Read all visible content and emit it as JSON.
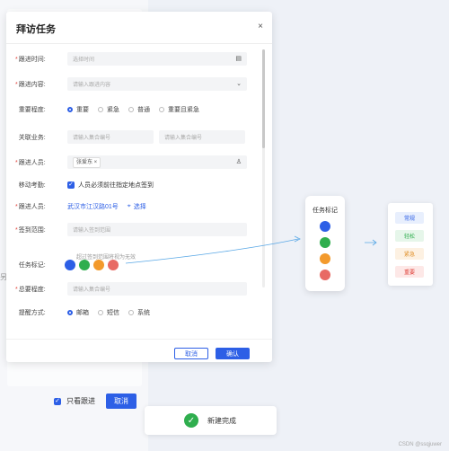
{
  "modal": {
    "title": "拜访任务",
    "close_icon": "×"
  },
  "form": {
    "follow_time": {
      "label": "跟进时间:",
      "placeholder": "选择时间"
    },
    "follow_content": {
      "label": "跟进内容:",
      "placeholder": "请输入跟进内容"
    },
    "importance": {
      "label": "重要程度:",
      "options": [
        "重要",
        "紧急",
        "普通",
        "重要且紧急"
      ],
      "selected": "重要"
    },
    "related_business": {
      "label": "关联业务:",
      "placeholder1": "请输入集合编号",
      "placeholder2": "请输入集合编号"
    },
    "follow_person": {
      "label": "跟进人员:",
      "tag": "张爱东"
    },
    "mobile_checkin": {
      "label": "移动考勤:",
      "text": "人员必须前往指定地点签到",
      "checked": true
    },
    "follow_person2": {
      "label": "跟进人员:",
      "location": "武汉市江汉路01号",
      "action": "选择"
    },
    "checkin_range": {
      "label": "签到范围:",
      "placeholder": "请输入签到范围",
      "hint": "超过签到范围将视为无效"
    },
    "task_tag": {
      "label": "任务标记:",
      "colors": [
        "#2d5fe6",
        "#2fae4e",
        "#f39a2c",
        "#e86a64"
      ]
    },
    "total_level": {
      "label": "总要程度:",
      "placeholder": "请输入集合编号"
    },
    "reminder": {
      "label": "提醒方式:",
      "options": [
        "邮箱",
        "短信",
        "系统"
      ],
      "selected": "邮箱"
    }
  },
  "buttons": {
    "cancel": "取消",
    "confirm": "确认"
  },
  "bottom_bar": {
    "checkbox_label": "只看跟进",
    "button": "取消"
  },
  "side_char": "另",
  "task_mark_card": {
    "title": "任务标记",
    "colors": [
      "#2d5fe6",
      "#2fae4e",
      "#f39a2c",
      "#e86a64"
    ]
  },
  "status_card": {
    "items": [
      {
        "label": "常规",
        "color": "#2d5fe6",
        "bg": "#e8effd"
      },
      {
        "label": "轻松",
        "color": "#2fae4e",
        "bg": "#e6f6ea"
      },
      {
        "label": "紧急",
        "color": "#e0902a",
        "bg": "#fdf1e2"
      },
      {
        "label": "重要",
        "color": "#e0433b",
        "bg": "#fde8e7"
      }
    ]
  },
  "toast": {
    "text": "新建完成"
  },
  "watermark": "CSDN @ssqjuwer"
}
